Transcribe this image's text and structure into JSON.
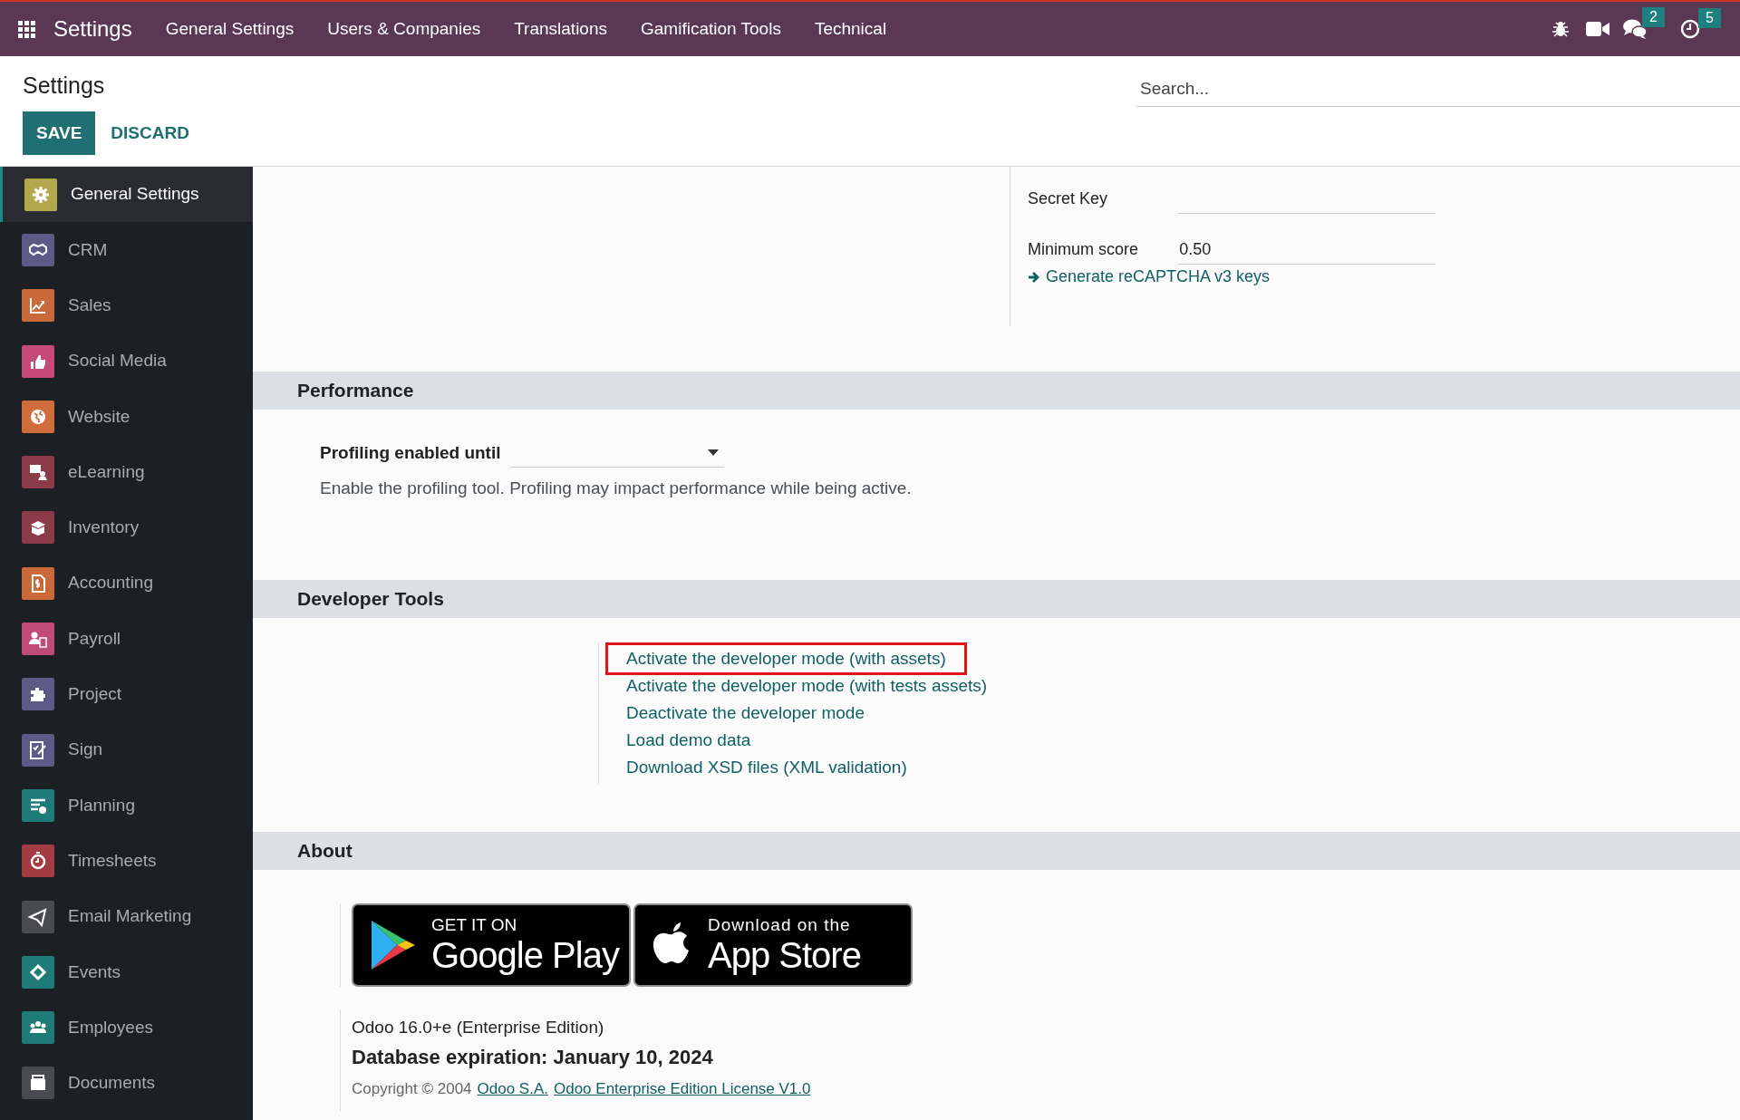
{
  "navbar": {
    "app_title": "Settings",
    "menus": [
      "General Settings",
      "Users & Companies",
      "Translations",
      "Gamification Tools",
      "Technical"
    ],
    "chat_count": "2",
    "activity_count": "5"
  },
  "control_panel": {
    "title": "Settings",
    "search": {
      "placeholder": "Search..."
    },
    "buttons": [
      {
        "label": "SAVE",
        "kind": "primary"
      },
      {
        "label": "DISCARD",
        "kind": "secondary"
      }
    ]
  },
  "sidebar": {
    "items": [
      {
        "label": "General Settings",
        "color": "#b3a74e",
        "selected": true
      },
      {
        "label": "CRM",
        "color": "#5c5b87",
        "selected": false
      },
      {
        "label": "Sales",
        "color": "#c9693a",
        "selected": false
      },
      {
        "label": "Social Media",
        "color": "#c64a78",
        "selected": false
      },
      {
        "label": "Website",
        "color": "#cf6e3a",
        "selected": false
      },
      {
        "label": "eLearning",
        "color": "#8b3a47",
        "selected": false
      },
      {
        "label": "Inventory",
        "color": "#8b3a47",
        "selected": false
      },
      {
        "label": "Accounting",
        "color": "#c9693a",
        "selected": false
      },
      {
        "label": "Payroll",
        "color": "#c04a78",
        "selected": false
      },
      {
        "label": "Project",
        "color": "#5c5b87",
        "selected": false
      },
      {
        "label": "Sign",
        "color": "#5c5b87",
        "selected": false
      },
      {
        "label": "Planning",
        "color": "#1f7b78",
        "selected": false
      },
      {
        "label": "Timesheets",
        "color": "#a23b42",
        "selected": false
      },
      {
        "label": "Email Marketing",
        "color": "#4a4b50",
        "selected": false
      },
      {
        "label": "Events",
        "color": "#1f7b78",
        "selected": false
      },
      {
        "label": "Employees",
        "color": "#1f7b78",
        "selected": false
      },
      {
        "label": "Documents",
        "color": "#4a4b50",
        "selected": false
      }
    ]
  },
  "recaptcha": {
    "fields": [
      {
        "label": "Secret Key"
      },
      {
        "label": "Minimum score",
        "value": "0.50"
      }
    ],
    "link": "Generate reCAPTCHA v3 keys"
  },
  "performance": {
    "title": "Performance",
    "field_label": "Profiling enabled until",
    "description": "Enable the profiling tool. Profiling may impact performance while being active."
  },
  "developer_tools": {
    "title": "Developer Tools",
    "links": [
      {
        "label": "Activate the developer mode (with assets)",
        "highlighted": true
      },
      {
        "label": "Activate the developer mode (with tests assets)",
        "highlighted": false
      },
      {
        "label": "Deactivate the developer mode",
        "highlighted": false
      },
      {
        "label": "Load demo data",
        "highlighted": false
      },
      {
        "label": "Download XSD files (XML validation)",
        "highlighted": false
      }
    ]
  },
  "about": {
    "title": "About",
    "badges": [
      {
        "kind": "google_play",
        "top": "GET IT ON",
        "bottom": "Google Play"
      },
      {
        "kind": "app_store",
        "top": "Download on the",
        "bottom": "App Store"
      }
    ],
    "version": "Odoo 16.0+e (Enterprise Edition)",
    "expiration": "Database expiration: January 10, 2024",
    "copyright": "Copyright © 2004",
    "links": [
      "Odoo S.A.",
      "Odoo Enterprise Edition License V1.0"
    ]
  }
}
